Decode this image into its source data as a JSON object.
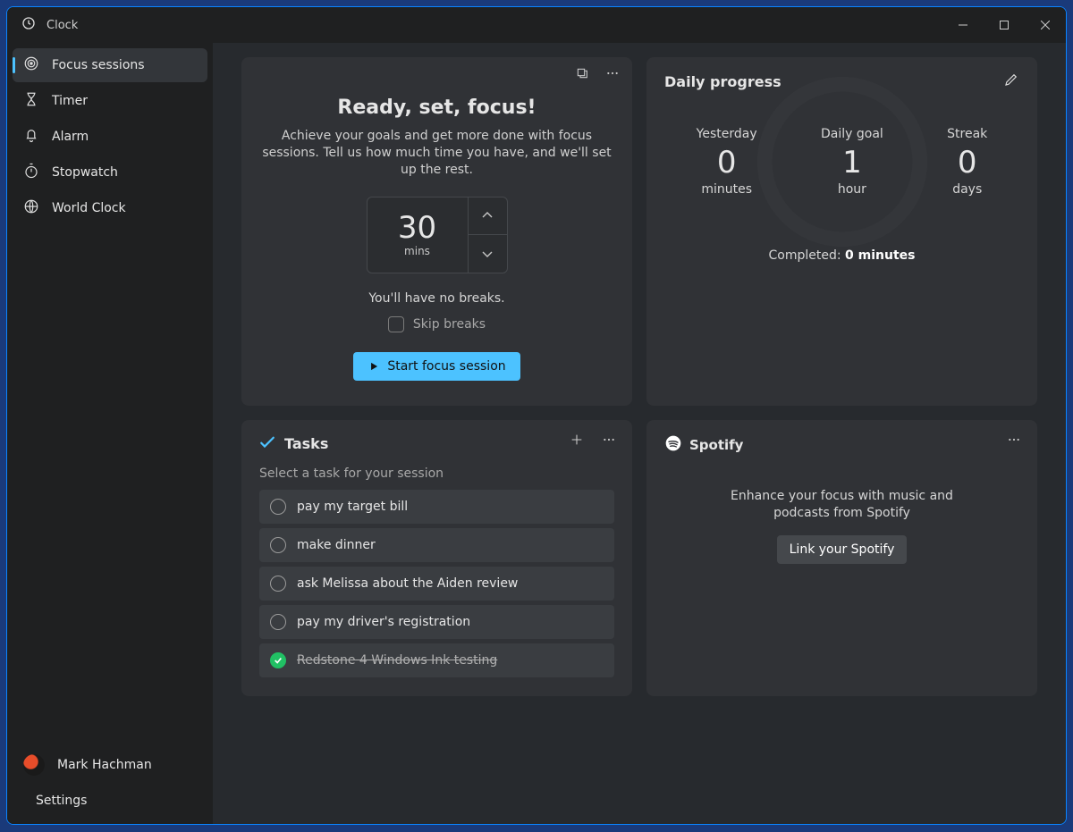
{
  "app_title": "Clock",
  "sidebar": {
    "items": [
      {
        "icon": "target",
        "label": "Focus sessions",
        "active": true
      },
      {
        "icon": "hourglass",
        "label": "Timer"
      },
      {
        "icon": "bell",
        "label": "Alarm"
      },
      {
        "icon": "stopwatch",
        "label": "Stopwatch"
      },
      {
        "icon": "globe",
        "label": "World Clock"
      }
    ],
    "user_name": "Mark Hachman",
    "settings_label": "Settings"
  },
  "focus": {
    "title": "Ready, set, focus!",
    "description": "Achieve your goals and get more done with focus sessions. Tell us how much time you have, and we'll set up the rest.",
    "duration_value": "30",
    "duration_unit": "mins",
    "breaks_hint": "You'll have no breaks.",
    "skip_breaks_label": "Skip breaks",
    "start_button": "Start focus session"
  },
  "progress": {
    "title": "Daily progress",
    "metrics": [
      {
        "label": "Yesterday",
        "value": "0",
        "unit": "minutes"
      },
      {
        "label": "Daily goal",
        "value": "1",
        "unit": "hour"
      },
      {
        "label": "Streak",
        "value": "0",
        "unit": "days"
      }
    ],
    "completed_prefix": "Completed: ",
    "completed_value": "0 minutes"
  },
  "tasks": {
    "title": "Tasks",
    "hint": "Select a task for your session",
    "items": [
      {
        "label": "pay my target bill",
        "done": false
      },
      {
        "label": "make dinner",
        "done": false
      },
      {
        "label": "ask Melissa about the Aiden review",
        "done": false
      },
      {
        "label": "pay my driver's registration",
        "done": false
      },
      {
        "label": "Redstone 4 Windows Ink testing",
        "done": true
      }
    ]
  },
  "spotify": {
    "title": "Spotify",
    "description": "Enhance your focus with music and podcasts from Spotify",
    "button": "Link your Spotify"
  }
}
